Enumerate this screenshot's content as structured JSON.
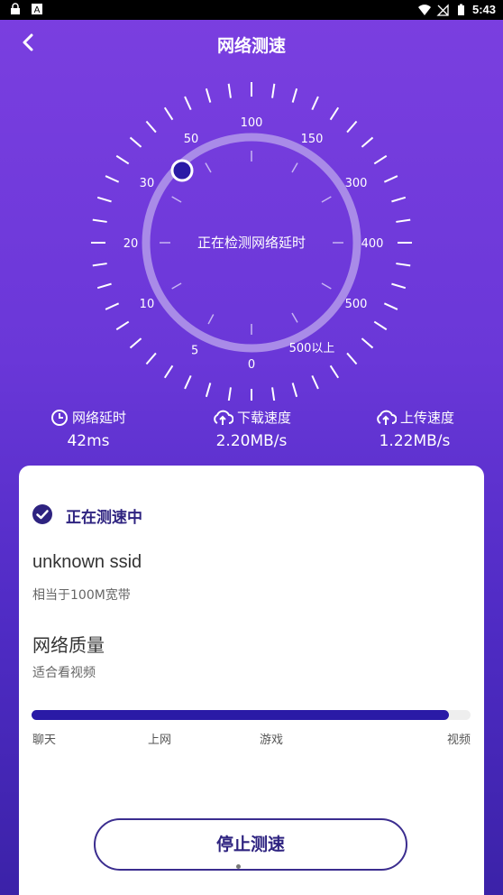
{
  "statusbar": {
    "time": "5:43"
  },
  "header": {
    "title": "网络测速"
  },
  "gauge": {
    "center_text": "正在检测网络延时",
    "scale_labels": [
      "0",
      "5",
      "10",
      "20",
      "30",
      "50",
      "100",
      "150",
      "300",
      "400",
      "500",
      "500以上"
    ],
    "indicator_value": "50"
  },
  "stats": [
    {
      "label": "网络延时",
      "value": "42ms",
      "icon": "clock-icon"
    },
    {
      "label": "下载速度",
      "value": "2.20MB/s",
      "icon": "cloud-download-icon"
    },
    {
      "label": "上传速度",
      "value": "1.22MB/s",
      "icon": "cloud-upload-icon"
    }
  ],
  "card": {
    "status": "正在测速中",
    "ssid": "unknown ssid",
    "bandwidth": "相当于100M宽带",
    "quality_title": "网络质量",
    "quality_desc": "适合看视频",
    "quality_level": 0.95,
    "quality_labels": [
      "聊天",
      "上网",
      "游戏",
      "视频"
    ],
    "stop_button": "停止测速"
  },
  "colors": {
    "accent": "#2e2380",
    "bar": "#2a1aa6",
    "bg_top": "#7b3fe0",
    "bg_bottom": "#3b22a8"
  }
}
